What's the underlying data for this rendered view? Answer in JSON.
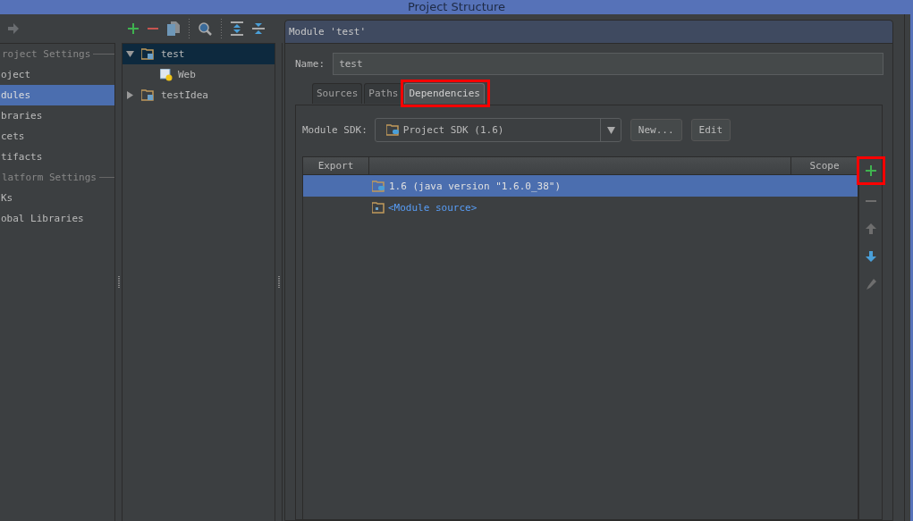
{
  "window": {
    "title": "Project Structure"
  },
  "nav": {
    "sections": [
      {
        "title": "roject Settings",
        "items": [
          {
            "label": "oject",
            "selected": false
          },
          {
            "label": "dules",
            "selected": true
          },
          {
            "label": "braries",
            "selected": false
          },
          {
            "label": "cets",
            "selected": false
          },
          {
            "label": "tifacts",
            "selected": false
          }
        ]
      },
      {
        "title": "latform Settings",
        "items": [
          {
            "label": "Ks",
            "selected": false
          },
          {
            "label": "obal Libraries",
            "selected": false
          }
        ]
      }
    ]
  },
  "tree": {
    "items": [
      {
        "label": "test",
        "kind": "module",
        "expanded": true,
        "selected": true,
        "children": [
          {
            "label": "Web",
            "kind": "facet",
            "selected": false
          }
        ]
      },
      {
        "label": "testIdea",
        "kind": "module",
        "expanded": false,
        "selected": false
      }
    ]
  },
  "module": {
    "title": "Module 'test'",
    "name_label": "Name:",
    "name_value": "test",
    "tabs": [
      {
        "label": "Sources",
        "selected": false,
        "highlighted": false
      },
      {
        "label": "Paths",
        "selected": false,
        "highlighted": false
      },
      {
        "label": "Dependencies",
        "selected": true,
        "highlighted": true
      }
    ],
    "sdk_label": "Module SDK:",
    "sdk_value": "Project SDK (1.6)",
    "buttons": [
      "New...",
      "Edit"
    ],
    "table": {
      "columns": [
        "Export",
        "Scope"
      ],
      "rows": [
        {
          "name": "1.6 (java version \"1.6.0_38\")",
          "kind": "sdk",
          "selected": true
        },
        {
          "name": "<Module source>",
          "kind": "source",
          "selected": false
        }
      ]
    },
    "side_tools": [
      {
        "kind": "add",
        "disabled": false,
        "highlighted": true
      },
      {
        "kind": "remove",
        "disabled": true,
        "highlighted": false
      },
      {
        "kind": "up",
        "disabled": true,
        "highlighted": false
      },
      {
        "kind": "down",
        "disabled": false,
        "highlighted": false
      },
      {
        "kind": "edit",
        "disabled": true,
        "highlighted": false
      }
    ]
  }
}
